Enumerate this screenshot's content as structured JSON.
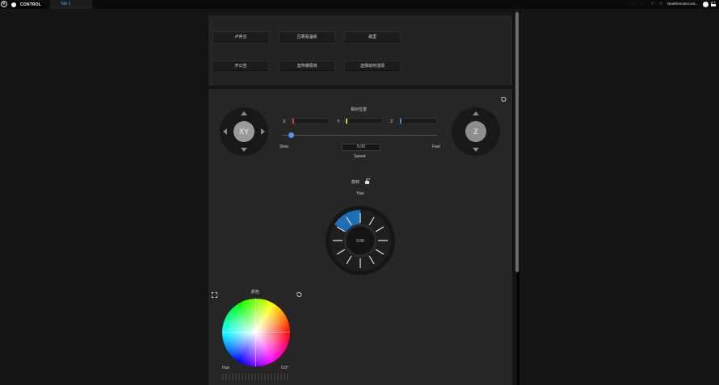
{
  "topbar": {
    "logo_text": "K",
    "app_name": "CONTROL",
    "tab_label": "Tab 1",
    "nav_back": "‹",
    "nav_forward": "›",
    "nav_undo": "↶",
    "nav_refresh": "↻",
    "remote_name": "NewRemoteCont..."
  },
  "buttons": [
    {
      "label": "卢序言"
    },
    {
      "label": "吕周看温绩"
    },
    {
      "label": "故里"
    },
    {
      "label": "开公告"
    },
    {
      "label": "怎所哪情境"
    },
    {
      "label": "选择如何活情"
    }
  ],
  "position": {
    "title": "相对位置",
    "xy_label": "XY",
    "z_label": "Z",
    "x_label": "X:",
    "y_label": "Y:",
    "z_field_label": "Z:",
    "slow_label": "Slow",
    "fast_label": "Fast",
    "speed_value": "5.00",
    "speed_label": "Speed",
    "speed_fraction": 0.04
  },
  "rotation": {
    "title": "旋转",
    "yaw_label": "Yaw",
    "yaw_value": "0.00"
  },
  "color": {
    "title": "颜色",
    "hue_label": "Hue",
    "hue_value": "0.0°"
  },
  "colors": {
    "accent": "#4aa3ff",
    "x_axis": "#e84040",
    "y_axis": "#d8d43a",
    "z_axis": "#3a8fe6",
    "dial_blue": "#1f6fb5"
  }
}
